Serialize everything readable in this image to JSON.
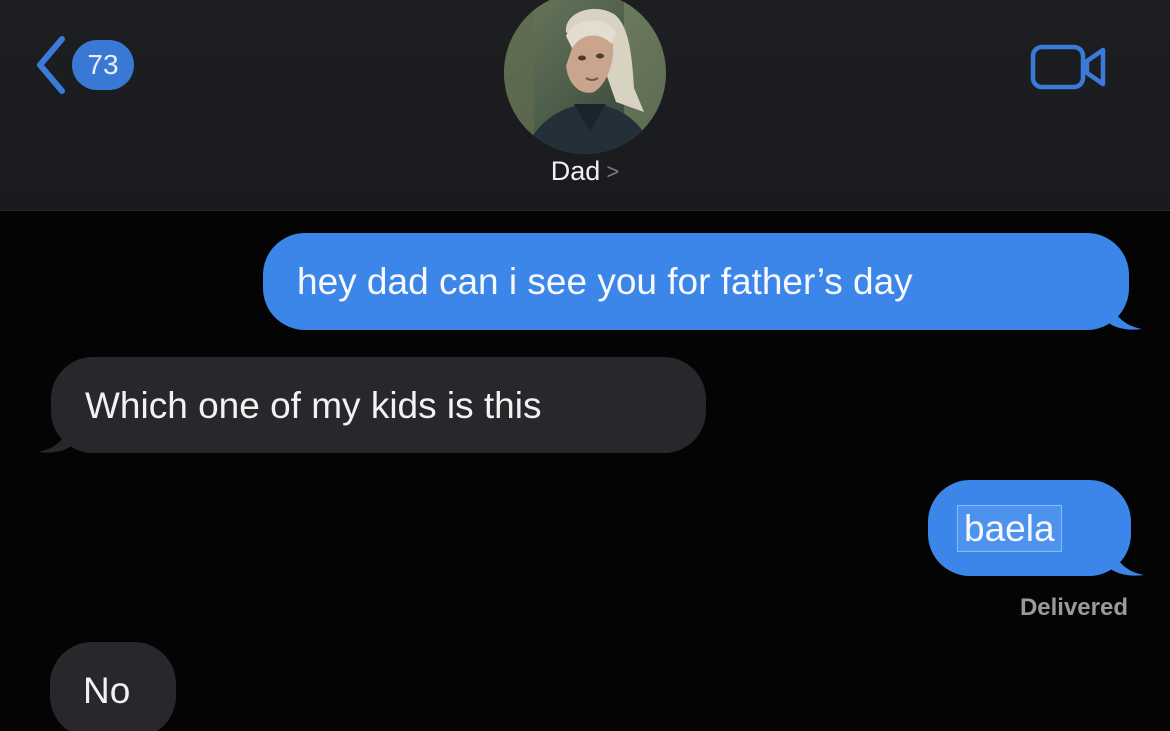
{
  "header": {
    "back_badge": "73",
    "contact_name": "Dad",
    "contact_chevron": ">",
    "accent": "#3a78d6"
  },
  "messages": [
    {
      "direction": "sent",
      "text": "hey dad can i see you for father’s day"
    },
    {
      "direction": "received",
      "text": "Which one of my kids is this"
    },
    {
      "direction": "sent",
      "text": "baela"
    },
    {
      "direction": "received",
      "text": "No"
    }
  ],
  "status": {
    "delivered": "Delivered"
  },
  "colors": {
    "sent_bubble": "#3c86ea",
    "received_bubble": "#28282c",
    "header_bg": "#1d1e22",
    "background": "#040404"
  },
  "icons": {
    "back": "chevron-left-icon",
    "video": "video-camera-icon"
  }
}
